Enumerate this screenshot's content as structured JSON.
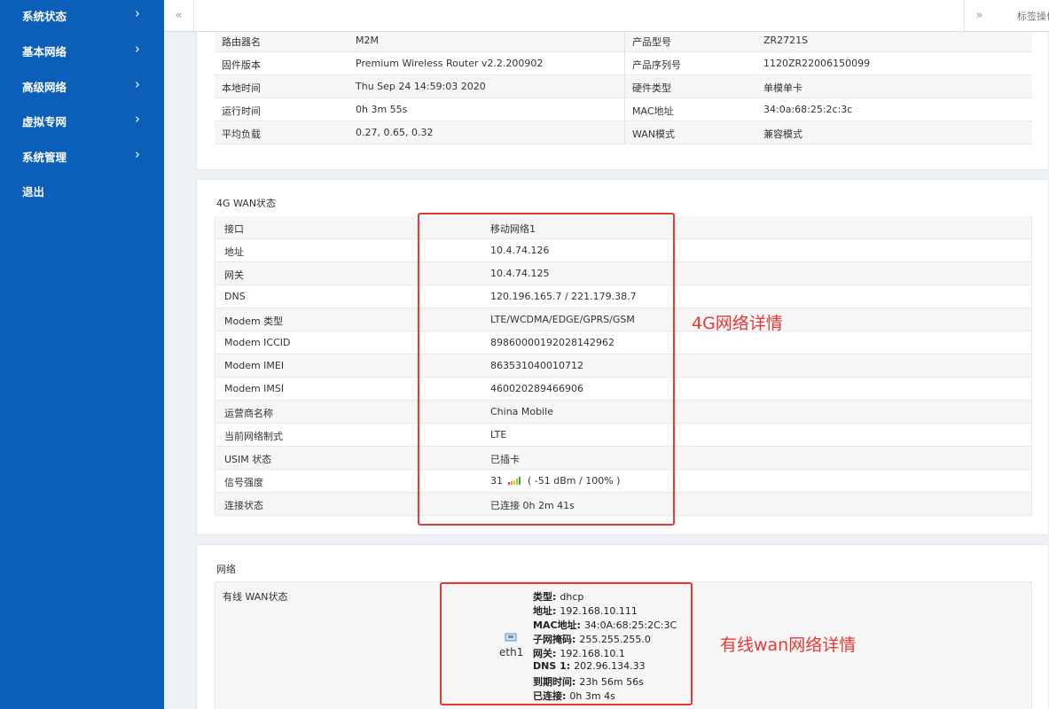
{
  "sidebar": {
    "items": [
      {
        "label": "系统状态",
        "chevron": "›"
      },
      {
        "label": "基本网络",
        "chevron": "›"
      },
      {
        "label": "高级网络",
        "chevron": "›"
      },
      {
        "label": "虚拟专网",
        "chevron": "›"
      },
      {
        "label": "系统管理",
        "chevron": "›"
      },
      {
        "label": "退出",
        "chevron": ""
      }
    ]
  },
  "topbar": {
    "left_icon": "«",
    "right_icon": "»",
    "tabs_label": "标签操作"
  },
  "system_info": {
    "rows": [
      {
        "k1": "路由器名",
        "v1": "M2M",
        "k2": "产品型号",
        "v2": "ZR2721S"
      },
      {
        "k1": "固件版本",
        "v1": "Premium Wireless Router v2.2.200902",
        "k2": "产品序列号",
        "v2": "1120ZR22006150099"
      },
      {
        "k1": "本地时间",
        "v1": "Thu Sep 24 14:59:03 2020",
        "k2": "硬件类型",
        "v2": "单模单卡"
      },
      {
        "k1": "运行时间",
        "v1": "0h 3m 55s",
        "k2": "MAC地址",
        "v2": "34:0a:68:25:2c:3c"
      },
      {
        "k1": "平均负载",
        "v1": "0.27, 0.65, 0.32",
        "k2": "WAN模式",
        "v2": "兼容模式"
      }
    ]
  },
  "wan4g": {
    "title": "4G WAN状态",
    "rows": [
      {
        "k": "接口",
        "v": "移动网络1"
      },
      {
        "k": "地址",
        "v": "10.4.74.126"
      },
      {
        "k": "网关",
        "v": "10.4.74.125"
      },
      {
        "k": "DNS",
        "v": "120.196.165.7 / 221.179.38.7"
      },
      {
        "k": "Modem 类型",
        "v": "LTE/WCDMA/EDGE/GPRS/GSM"
      },
      {
        "k": "Modem ICCID",
        "v": "89860000192028142962"
      },
      {
        "k": "Modem IMEI",
        "v": "863531040010712"
      },
      {
        "k": "Modem IMSI",
        "v": "460020289466906"
      },
      {
        "k": "运营商名称",
        "v": "China Mobile"
      },
      {
        "k": "当前网络制式",
        "v": "LTE"
      },
      {
        "k": "USIM 状态",
        "v": "已插卡"
      },
      {
        "k": "信号强度",
        "v": "31"
      },
      {
        "k": "连接状态",
        "v": "已连接 0h 2m 41s"
      }
    ],
    "signal_detail": "( -51 dBm / 100% )",
    "annotation": "4G网络详情"
  },
  "network": {
    "title": "网络",
    "wired_label": "有线 WAN状态",
    "iface": "eth1",
    "details": [
      {
        "k": "类型:",
        "v": "dhcp"
      },
      {
        "k": "地址:",
        "v": "192.168.10.111"
      },
      {
        "k": "MAC地址:",
        "v": "34:0A:68:25:2C:3C"
      },
      {
        "k": "子网掩码:",
        "v": "255.255.255.0"
      },
      {
        "k": "网关:",
        "v": "192.168.10.1"
      },
      {
        "k": "DNS 1:",
        "v": "202.96.134.33"
      },
      {
        "k": "到期时间:",
        "v": "23h 56m 56s"
      },
      {
        "k": "已连接:",
        "v": "0h 3m 4s"
      }
    ],
    "annotation": "有线wan网络详情"
  },
  "colors": {
    "sidebar": "#0b5fb9",
    "annotation_red": "#e53935"
  }
}
